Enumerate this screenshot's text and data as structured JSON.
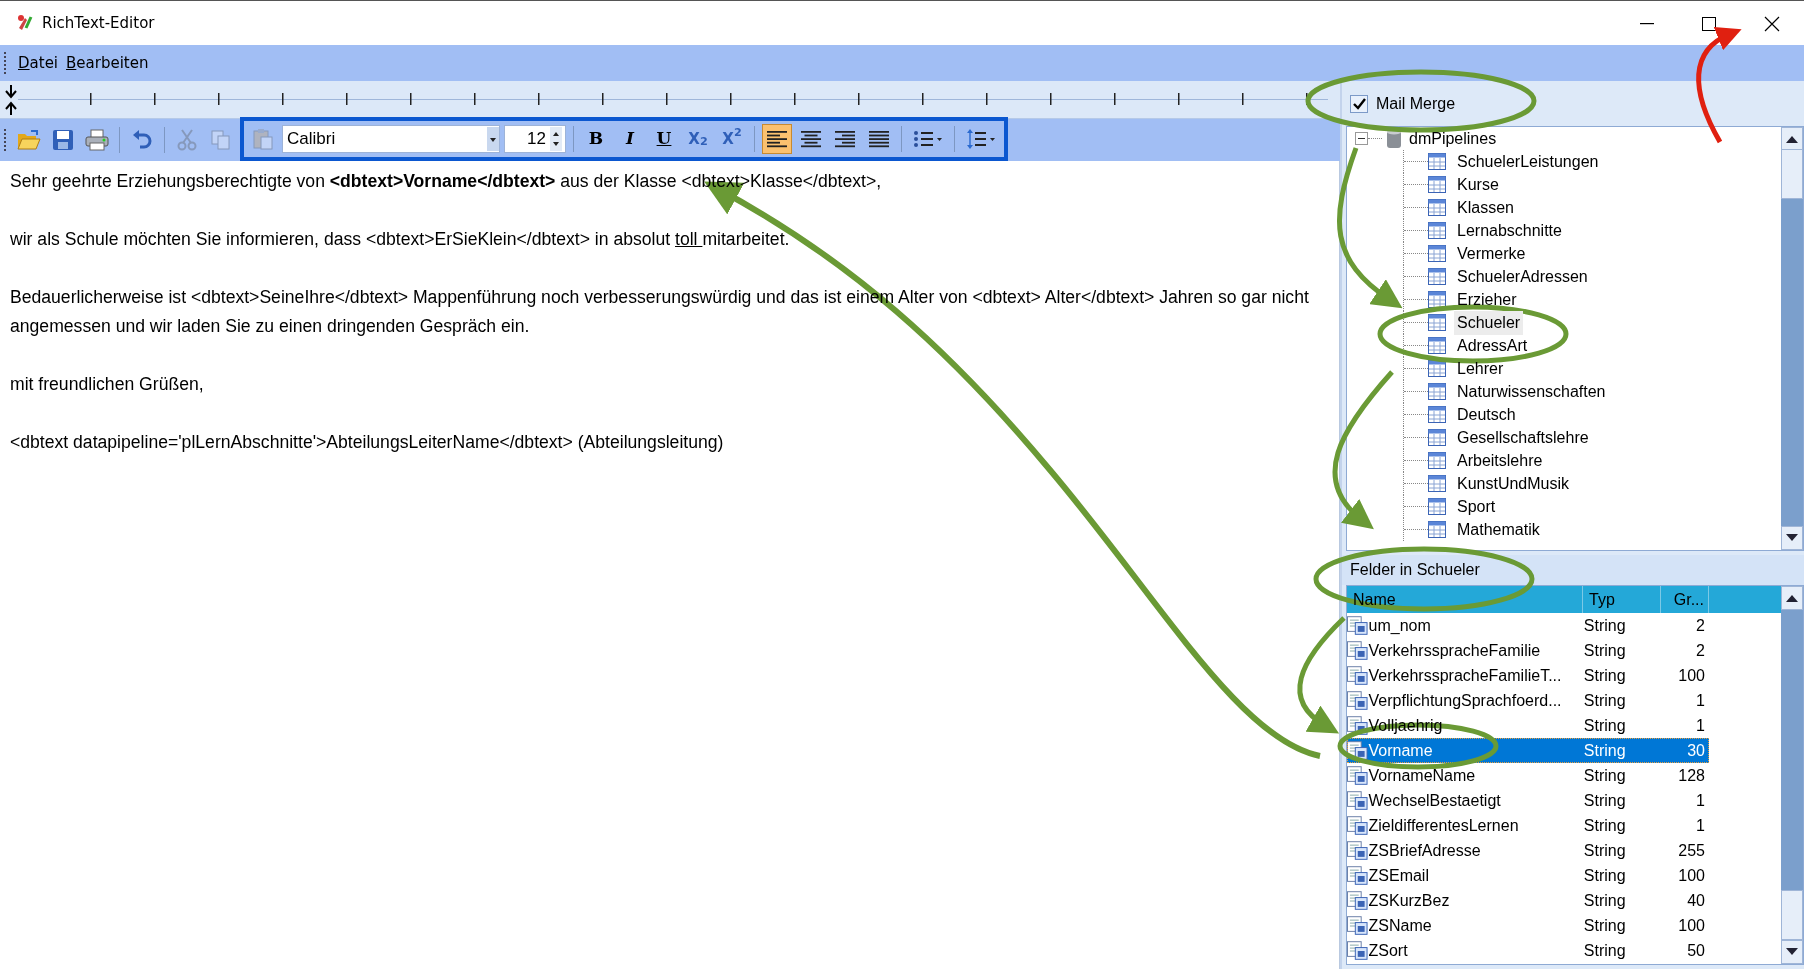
{
  "window": {
    "title": "RichText-Editor"
  },
  "menu": [
    {
      "mnemonic": "D",
      "rest": "atei"
    },
    {
      "mnemonic": "B",
      "rest": "earbeiten"
    }
  ],
  "toolbar": {
    "file_buttons": [
      {
        "kind": "open",
        "disabled": false
      },
      {
        "kind": "save",
        "disabled": false
      },
      {
        "kind": "print",
        "disabled": false
      },
      {
        "kind": "undo",
        "disabled": false
      },
      {
        "kind": "cut",
        "disabled": true
      },
      {
        "kind": "copy",
        "disabled": true
      },
      {
        "kind": "paste",
        "disabled": true
      }
    ],
    "font": "Calibri",
    "size": "12",
    "format_buttons": [
      {
        "kind": "bold",
        "label": "B"
      },
      {
        "kind": "italic",
        "label": "I"
      },
      {
        "kind": "underline",
        "label": "U"
      },
      {
        "kind": "subscript",
        "label": "X$_{2}$"
      },
      {
        "kind": "superscript",
        "label": "X$^{2}$"
      }
    ],
    "align_buttons": [
      {
        "kind": "left",
        "selected": true
      },
      {
        "kind": "center",
        "selected": false
      },
      {
        "kind": "right",
        "selected": false
      },
      {
        "kind": "justify",
        "selected": false
      }
    ],
    "list_buttons": [
      {
        "kind": "bullets"
      },
      {
        "kind": "spacing"
      }
    ]
  },
  "document": [
    {
      "kind": "body",
      "runs": [
        {
          "text": "Sehr geehrte Erziehungsberechtigte von "
        },
        {
          "text": "<dbtext>Vorname</dbtext>",
          "bold": true
        },
        {
          "text": " aus der Klasse <dbtext>Klasse</dbtext>,"
        }
      ]
    },
    {
      "kind": "body",
      "runs": [
        {
          "text": "wir als Schule möchten Sie informieren, dass <dbtext>ErSieKlein</dbtext> in absolut "
        },
        {
          "text": "toll ",
          "underline": true
        },
        {
          "text": "mitarbeitet."
        }
      ]
    },
    {
      "kind": "body",
      "runs": [
        {
          "text": "Bedauerlicherweise ist <dbtext>SeineIhre</dbtext> Mappenführung noch verbesserungswürdig und das ist einem Alter von <dbtext> Alter</dbtext> Jahren so gar nicht angemessen und wir laden Sie zu einen dringenden Gespräch ein."
        }
      ]
    },
    {
      "kind": "body",
      "runs": [
        {
          "text": "mit freundlichen Grüßen,"
        }
      ]
    },
    {
      "kind": "signature",
      "runs": [
        {
          "text": "<dbtext datapipeline='plLernAbschnitte'>AbteilungsLeiterName</dbtext> (Abteilungsleitung)"
        }
      ]
    }
  ],
  "mail_merge": {
    "label": "Mail Merge",
    "checked": true
  },
  "tree": {
    "label": "dmPipelines",
    "expanded": true,
    "children": [
      {
        "label": "SchuelerLeistungen",
        "selected": false
      },
      {
        "label": "Kurse",
        "selected": false
      },
      {
        "label": "Klassen",
        "selected": false
      },
      {
        "label": "Lernabschnitte",
        "selected": false
      },
      {
        "label": "Vermerke",
        "selected": false
      },
      {
        "label": "SchuelerAdressen",
        "selected": false
      },
      {
        "label": "Erzieher",
        "selected": false
      },
      {
        "label": "Schueler",
        "selected": true
      },
      {
        "label": "AdressArt",
        "selected": false
      },
      {
        "label": "Lehrer",
        "selected": false
      },
      {
        "label": "Naturwissenschaften",
        "selected": false
      },
      {
        "label": "Deutsch",
        "selected": false
      },
      {
        "label": "Gesellschaftslehre",
        "selected": false
      },
      {
        "label": "Arbeitslehre",
        "selected": false
      },
      {
        "label": "KunstUndMusik",
        "selected": false
      },
      {
        "label": "Sport",
        "selected": false
      },
      {
        "label": "Mathematik",
        "selected": false
      }
    ]
  },
  "fields": {
    "title": "Felder in Schueler",
    "columns": [
      "Name",
      "Typ",
      "Gr..."
    ],
    "rows": [
      {
        "name": "um_nom",
        "type": "String",
        "size": "2",
        "selected": false
      },
      {
        "name": "VerkehrsspracheFamilie",
        "type": "String",
        "size": "2",
        "selected": false
      },
      {
        "name": "VerkehrsspracheFamilieT...",
        "type": "String",
        "size": "100",
        "selected": false
      },
      {
        "name": "VerpflichtungSprachfoerd...",
        "type": "String",
        "size": "1",
        "selected": false
      },
      {
        "name": "Volljaehrig",
        "type": "String",
        "size": "1",
        "selected": false
      },
      {
        "name": "Vorname",
        "type": "String",
        "size": "30",
        "selected": true
      },
      {
        "name": "VornameName",
        "type": "String",
        "size": "128",
        "selected": false
      },
      {
        "name": "WechselBestaetigt",
        "type": "String",
        "size": "1",
        "selected": false
      },
      {
        "name": "ZieldifferentesLernen",
        "type": "String",
        "size": "1",
        "selected": false
      },
      {
        "name": "ZSBriefAdresse",
        "type": "String",
        "size": "255",
        "selected": false
      },
      {
        "name": "ZSEmail",
        "type": "String",
        "size": "100",
        "selected": false
      },
      {
        "name": "ZSKurzBez",
        "type": "String",
        "size": "40",
        "selected": false
      },
      {
        "name": "ZSName",
        "type": "String",
        "size": "100",
        "selected": false
      },
      {
        "name": "ZSort",
        "type": "String",
        "size": "50",
        "selected": false
      }
    ]
  }
}
